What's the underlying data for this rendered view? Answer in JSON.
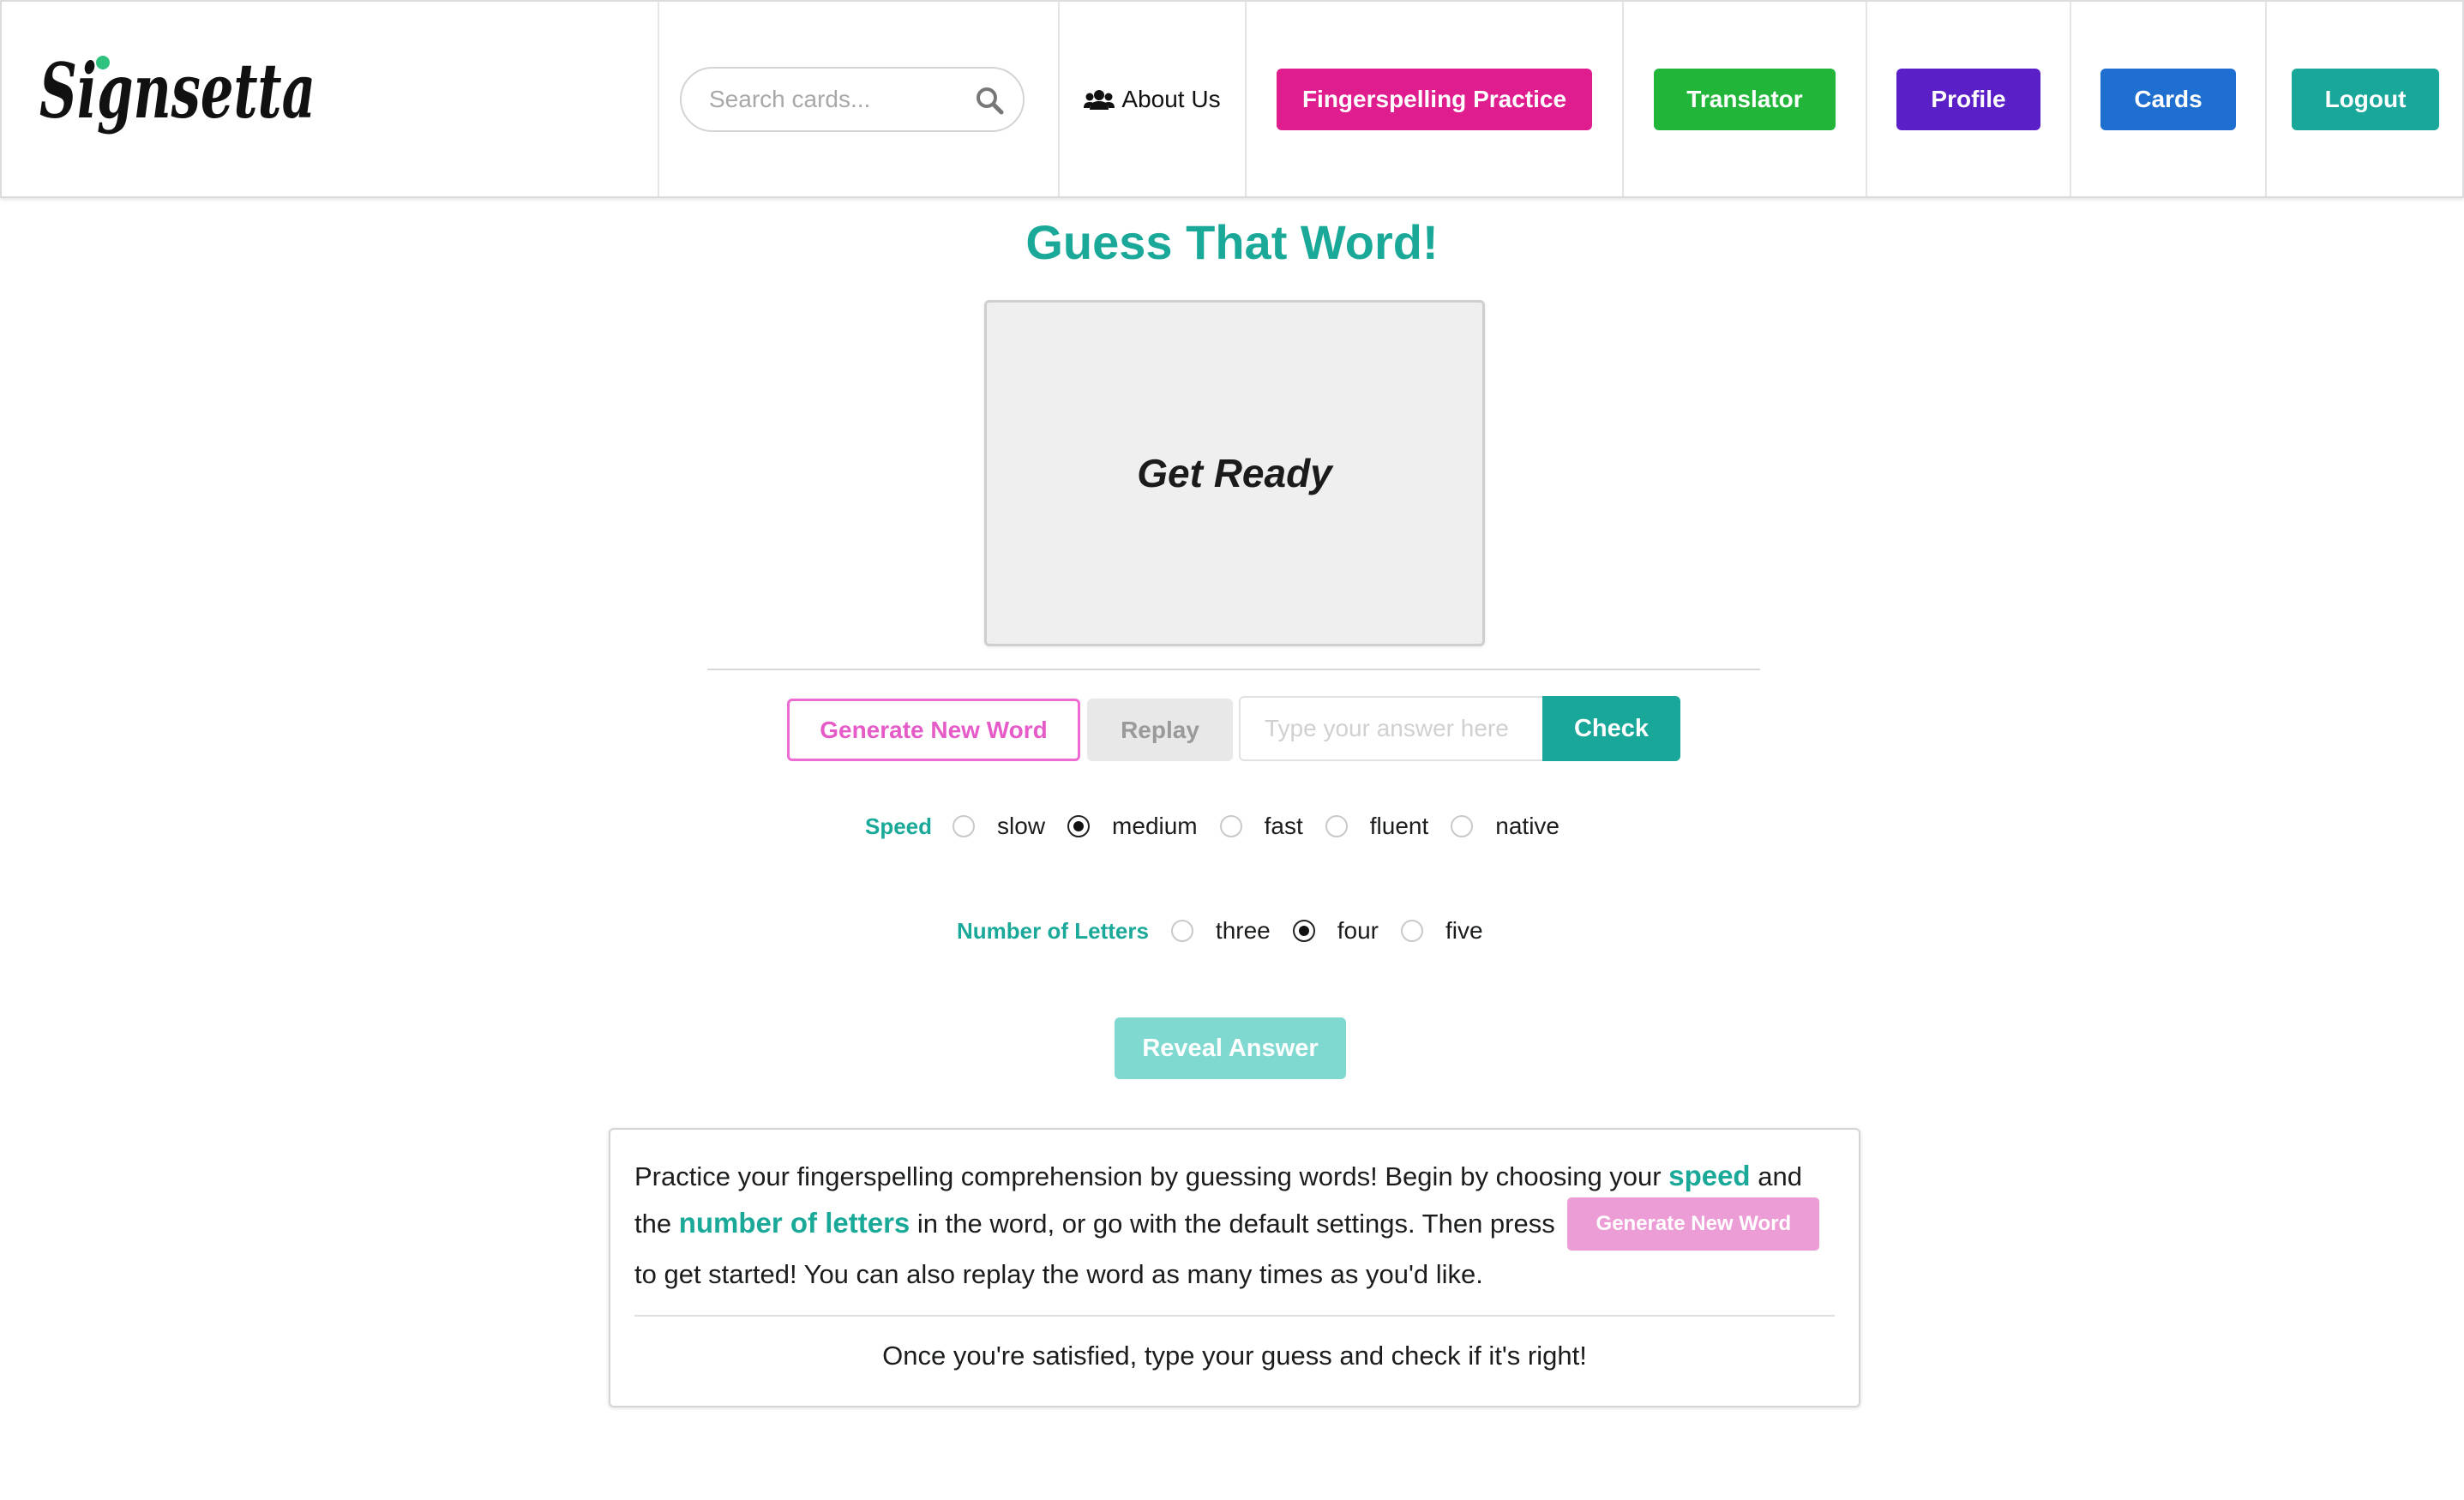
{
  "navbar": {
    "logo_text": "Signsetta",
    "search": {
      "placeholder": "Search cards..."
    },
    "about_label": "About Us",
    "buttons": [
      {
        "label": "Fingerspelling Practice",
        "color": "#e01d8e"
      },
      {
        "label": "Translator",
        "color": "#21b63a"
      },
      {
        "label": "Profile",
        "color": "#5a1fc7"
      },
      {
        "label": "Cards",
        "color": "#1e6fd0"
      },
      {
        "label": "Logout",
        "color": "#19a79a"
      }
    ]
  },
  "main": {
    "title": "Guess That Word!",
    "display_text": "Get Ready",
    "generate_label": "Generate New Word",
    "replay_label": "Replay",
    "answer_placeholder": "Type your answer here",
    "check_label": "Check",
    "speed": {
      "label": "Speed",
      "options": [
        "slow",
        "medium",
        "fast",
        "fluent",
        "native"
      ],
      "selected": "medium"
    },
    "letters": {
      "label": "Number of Letters",
      "options": [
        "three",
        "four",
        "five"
      ],
      "selected": "four"
    },
    "reveal_label": "Reveal Answer"
  },
  "info": {
    "part1": "Practice your fingerspelling comprehension by guessing words! Begin by choosing your ",
    "speed_word": "speed",
    "part2": " and the ",
    "letters_word": "number of letters",
    "part3": " in the word, or go with the default settings. Then press ",
    "button_label": "Generate New Word",
    "part4": " to get started! You can also replay the word as many times as you'd like.",
    "footer": "Once you're satisfied, type your guess and check if it's right!"
  },
  "colors": {
    "accent": "#1aa999",
    "pink": "#e55cc8"
  }
}
